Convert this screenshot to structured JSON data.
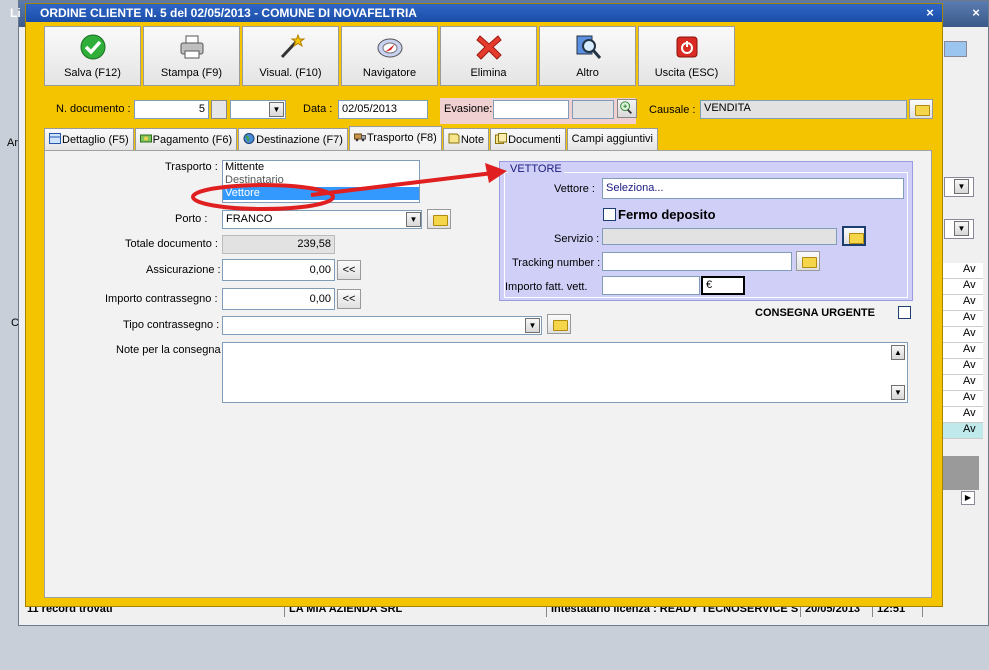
{
  "window": {
    "title": "ORDINE CLIENTE N. 5 del 02/05/2013 - COMUNE DI NOVAFELTRIA",
    "title_prefix": "Li",
    "close": "×"
  },
  "toolbar": [
    {
      "label": "Salva (F12)",
      "icon": "check-icon"
    },
    {
      "label": "Stampa (F9)",
      "icon": "printer-icon"
    },
    {
      "label": "Visual. (F10)",
      "icon": "magic-wand-icon"
    },
    {
      "label": "Navigatore",
      "icon": "compass-icon"
    },
    {
      "label": "Elimina",
      "icon": "delete-x-icon"
    },
    {
      "label": "Altro",
      "icon": "magnifier-icon"
    },
    {
      "label": "Uscita (ESC)",
      "icon": "power-icon"
    }
  ],
  "header": {
    "ndoc_label": "N. documento :",
    "ndoc_value": "5",
    "data_label": "Data :",
    "data_value": "02/05/2013",
    "evasione_label": "Evasione:",
    "causale_label": "Causale :",
    "causale_value": "VENDITA"
  },
  "tabs": [
    {
      "label": "Dettaglio (F5)",
      "icon": "grid-icon"
    },
    {
      "label": "Pagamento (F6)",
      "icon": "money-icon"
    },
    {
      "label": "Destinazione (F7)",
      "icon": "globe-icon"
    },
    {
      "label": "Trasporto (F8)",
      "icon": "truck-icon",
      "active": true
    },
    {
      "label": "Note",
      "icon": "note-icon"
    },
    {
      "label": "Documenti",
      "icon": "documents-icon"
    },
    {
      "label": "Campi aggiuntivi",
      "icon": ""
    }
  ],
  "trasporto": {
    "label": "Trasporto :",
    "options": [
      "Mittente",
      "Destinatario",
      "Vettore"
    ],
    "selected": "Vettore",
    "porto_label": "Porto :",
    "porto_value": "FRANCO",
    "totale_label": "Totale documento :",
    "totale_value": "239,58",
    "assicurazione_label": "Assicurazione :",
    "assicurazione_value": "0,00",
    "contrassegno_label": "Importo contrassegno :",
    "contrassegno_value": "0,00",
    "tipo_contrassegno_label": "Tipo contrassegno :",
    "note_label": "Note per la consegna",
    "dbl_left": "<<"
  },
  "vettore": {
    "legend": "VETTORE",
    "vettore_label": "Vettore :",
    "vettore_value": "Seleziona...",
    "fermo_label": "Fermo deposito",
    "servizio_label": "Servizio :",
    "tracking_label": "Tracking number :",
    "importo_label": "Importo fatt. vett.",
    "currency": "€"
  },
  "consegna_urgente_label": "CONSEGNA URGENTE",
  "statusbar": {
    "records": "11 record trovati",
    "azienda": "LA MIA AZIENDA SRL",
    "licenza": "Intestatario licenza : READY TECNOSERVICE S",
    "date": "20/05/2013",
    "time": "12:51"
  },
  "background": {
    "left_labels": [
      "Ar",
      "C"
    ],
    "list_prefix": "Av",
    "list_count": 11
  },
  "colors": {
    "window_bg": "#f5c400",
    "title_bar": "#1b4ea8",
    "vettore_bg": "#cfcff7",
    "annotation": "#e02020"
  }
}
